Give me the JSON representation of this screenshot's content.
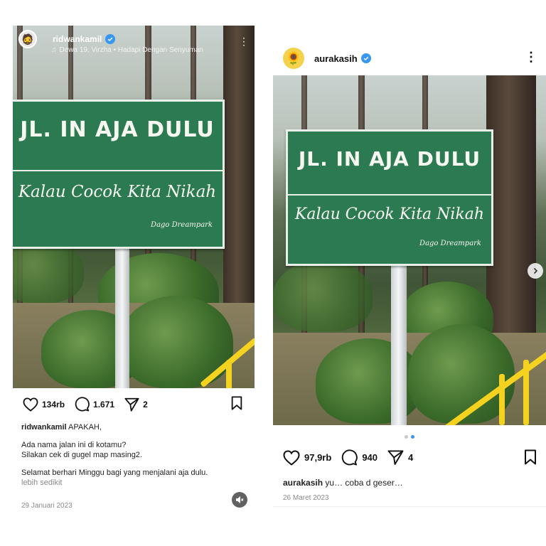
{
  "left_post": {
    "username": "ridwankamil",
    "music": "Dewa 19, Virzha • Hadapi Dengan Senyuman",
    "sign": {
      "line1": "JL. IN AJA DULU",
      "line2": "Kalau Cocok Kita Nikah",
      "credit": "Dago Dreampark"
    },
    "likes": "134rb",
    "comments": "1.671",
    "shares": "2",
    "caption_user": "ridwankamil",
    "caption_title": "APAKAH,",
    "caption_lines": [
      "Ada nama jalan ini di kotamu?",
      "Silakan cek di gugel map masing2."
    ],
    "caption_closing": "Selamat berhari Minggu bagi yang menjalani aja dulu.",
    "more_label": "lebih sedikit",
    "date": "29 Januari 2023"
  },
  "right_post": {
    "username": "aurakasih",
    "sign": {
      "line1": "JL. IN AJA DULU",
      "line2": "Kalau Cocok Kita Nikah",
      "credit": "Dago Dreampark"
    },
    "likes": "97,9rb",
    "comments": "940",
    "shares": "4",
    "caption_user": "aurakasih",
    "caption_text": "yu… coba d geser…",
    "date": "26 Maret 2023",
    "carousel": {
      "total": 2,
      "active": 2
    }
  },
  "icons": {
    "heart": "heart-icon",
    "comment": "comment-icon",
    "share": "send-icon",
    "save": "bookmark-icon",
    "verified": "verified-badge-icon",
    "music": "music-note-icon",
    "more": "more-options-icon",
    "mute": "speaker-muted-icon",
    "next": "chevron-right-icon"
  },
  "colors": {
    "sign_green": "#2c7a52",
    "verified_blue": "#3897f0",
    "rail_yellow": "#f4d21f"
  }
}
